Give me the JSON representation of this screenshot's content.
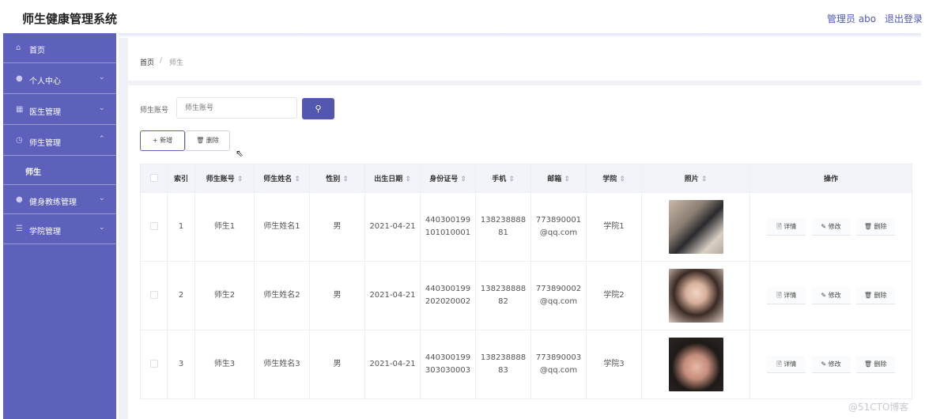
{
  "header": {
    "title": "师生健康管理系统",
    "admin": "管理员 abo",
    "logout": "退出登录"
  },
  "sidebar": {
    "items": [
      {
        "icon": "home-icon",
        "glyph": "⌂",
        "label": "首页",
        "arrow": ""
      },
      {
        "icon": "user-icon",
        "glyph": "●",
        "label": "个人中心",
        "arrow": "⌄"
      },
      {
        "icon": "grid-icon",
        "glyph": "▦",
        "label": "医生管理",
        "arrow": "⌄"
      },
      {
        "icon": "clock-icon",
        "glyph": "◷",
        "label": "师生管理",
        "arrow": "⌃"
      },
      {
        "icon": "user-icon",
        "glyph": "●",
        "label": "健身教练管理",
        "arrow": "⌄"
      },
      {
        "icon": "menu-icon",
        "glyph": "☰",
        "label": "学院管理",
        "arrow": "⌄"
      }
    ],
    "subitem": "师生"
  },
  "breadcrumb": {
    "home": "首页",
    "sep": "/",
    "current": "师生"
  },
  "search": {
    "label": "师生账号",
    "placeholder": "师生账号",
    "button_icon": "search-icon",
    "button_glyph": "⚲"
  },
  "actions": {
    "add": "+ 新增",
    "delete": "🗑 删除"
  },
  "table": {
    "headers": [
      "索引",
      "师生账号",
      "师生姓名",
      "性别",
      "出生日期",
      "身份证号",
      "手机",
      "邮箱",
      "学院",
      "照片",
      "操作"
    ],
    "sort_glyph": "⇕",
    "rows": [
      {
        "index": "1",
        "account": "师生1",
        "name": "师生姓名1",
        "gender": "男",
        "birth": "2021-04-21",
        "id1": "440300199",
        "id2": "101010001",
        "phone1": "138238888",
        "phone2": "81",
        "email1": "773890001",
        "email2": "@qq.com",
        "college": "学院1"
      },
      {
        "index": "2",
        "account": "师生2",
        "name": "师生姓名2",
        "gender": "男",
        "birth": "2021-04-21",
        "id1": "440300199",
        "id2": "202020002",
        "phone1": "138238888",
        "phone2": "82",
        "email1": "773890002",
        "email2": "@qq.com",
        "college": "学院2"
      },
      {
        "index": "3",
        "account": "师生3",
        "name": "师生姓名3",
        "gender": "男",
        "birth": "2021-04-21",
        "id1": "440300199",
        "id2": "303030003",
        "phone1": "138238888",
        "phone2": "83",
        "email1": "773890003",
        "email2": "@qq.com",
        "college": "学院3"
      }
    ],
    "ops": {
      "detail": "🗎 详情",
      "edit": "✎ 修改",
      "delete": "🗑 删除"
    }
  },
  "watermark": "@51CTO博客"
}
